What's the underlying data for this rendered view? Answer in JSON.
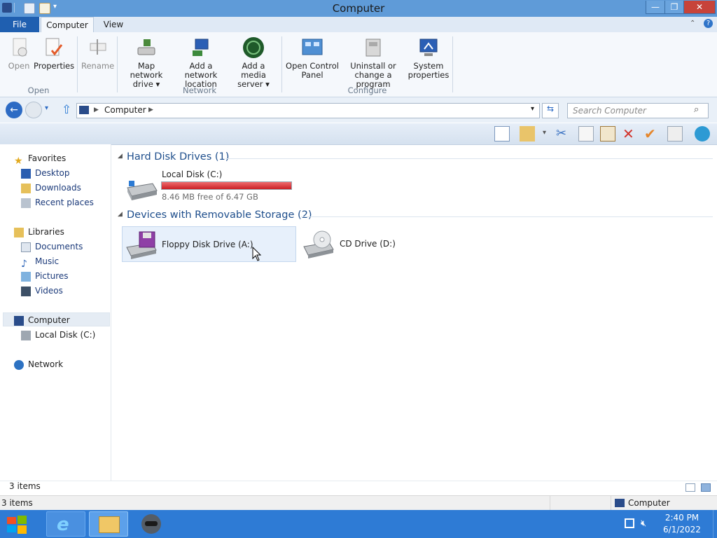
{
  "window": {
    "title": "Computer",
    "controls": {
      "minimize": "—",
      "maximize": "❐",
      "close": "✕"
    }
  },
  "ribbon": {
    "tabs": [
      "File",
      "Computer",
      "View"
    ],
    "groups": {
      "open": {
        "label": "Open",
        "buttons": [
          {
            "label": "Open",
            "icon": "open-icon",
            "enabled": false
          },
          {
            "label": "Properties",
            "icon": "properties-icon",
            "enabled": true
          },
          {
            "label": "Rename",
            "icon": "rename-icon",
            "enabled": false
          }
        ]
      },
      "network": {
        "label": "Network",
        "buttons": [
          {
            "line1": "Map network",
            "line2": "drive ▾",
            "icon": "map-network-drive-icon"
          },
          {
            "line1": "Add a network",
            "line2": "location",
            "icon": "add-network-location-icon"
          },
          {
            "line1": "Add a media",
            "line2": "server ▾",
            "icon": "media-server-icon"
          }
        ]
      },
      "configure": {
        "label": "Configure",
        "buttons": [
          {
            "line1": "Open Control",
            "line2": "Panel",
            "icon": "control-panel-icon"
          },
          {
            "line1": "Uninstall or",
            "line2": "change a program",
            "icon": "uninstall-icon"
          },
          {
            "line1": "System",
            "line2": "properties",
            "icon": "system-properties-icon"
          }
        ]
      }
    }
  },
  "address": {
    "path": "Computer",
    "search_placeholder": "Search Computer"
  },
  "nav": {
    "favorites": {
      "label": "Favorites",
      "items": [
        "Desktop",
        "Downloads",
        "Recent places"
      ]
    },
    "libraries": {
      "label": "Libraries",
      "items": [
        "Documents",
        "Music",
        "Pictures",
        "Videos"
      ]
    },
    "computer": {
      "label": "Computer",
      "items": [
        "Local Disk (C:)"
      ]
    },
    "network": {
      "label": "Network"
    }
  },
  "content": {
    "hard_disk_group": "Hard Disk Drives (1)",
    "removable_group": "Devices with Removable Storage (2)",
    "local_disk": {
      "name": "Local Disk (C:)",
      "free_text": "8.46 MB free of 6.47 GB",
      "used_fraction": 0.9987,
      "bar_color": "#d8232a"
    },
    "floppy": {
      "name": "Floppy Disk Drive (A:)"
    },
    "cd": {
      "name": "CD Drive (D:)"
    }
  },
  "status": {
    "items_count": "3 items",
    "items_count_bottom": "3 items",
    "location": "Computer"
  },
  "taskbar": {
    "time": "2:40 PM",
    "date": "6/1/2022"
  }
}
